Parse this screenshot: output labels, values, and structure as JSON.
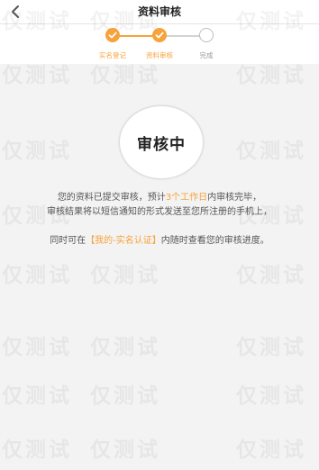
{
  "header": {
    "title": "资料审核",
    "back_icon": "chevron-left-icon"
  },
  "steps": [
    {
      "label": "实名登记",
      "state": "done"
    },
    {
      "label": "资料审核",
      "state": "done"
    },
    {
      "label": "完成",
      "state": "todo"
    }
  ],
  "status": {
    "title": "审核中"
  },
  "message": {
    "line1_pre": "您的资料已提交审核，预计",
    "line1_highlight": "3个工作日",
    "line1_post": "内审核完毕，",
    "line2": "审核结果将以短信通知的形式发送至您所注册的手机上，",
    "line3_pre": "同时可在",
    "line3_link": "【我的-实名认证】",
    "line3_post": "内随时查看您的审核进度。"
  },
  "watermark": {
    "text": "仅测试"
  },
  "colors": {
    "accent": "#f7a23a",
    "background": "#f3f3f3"
  }
}
